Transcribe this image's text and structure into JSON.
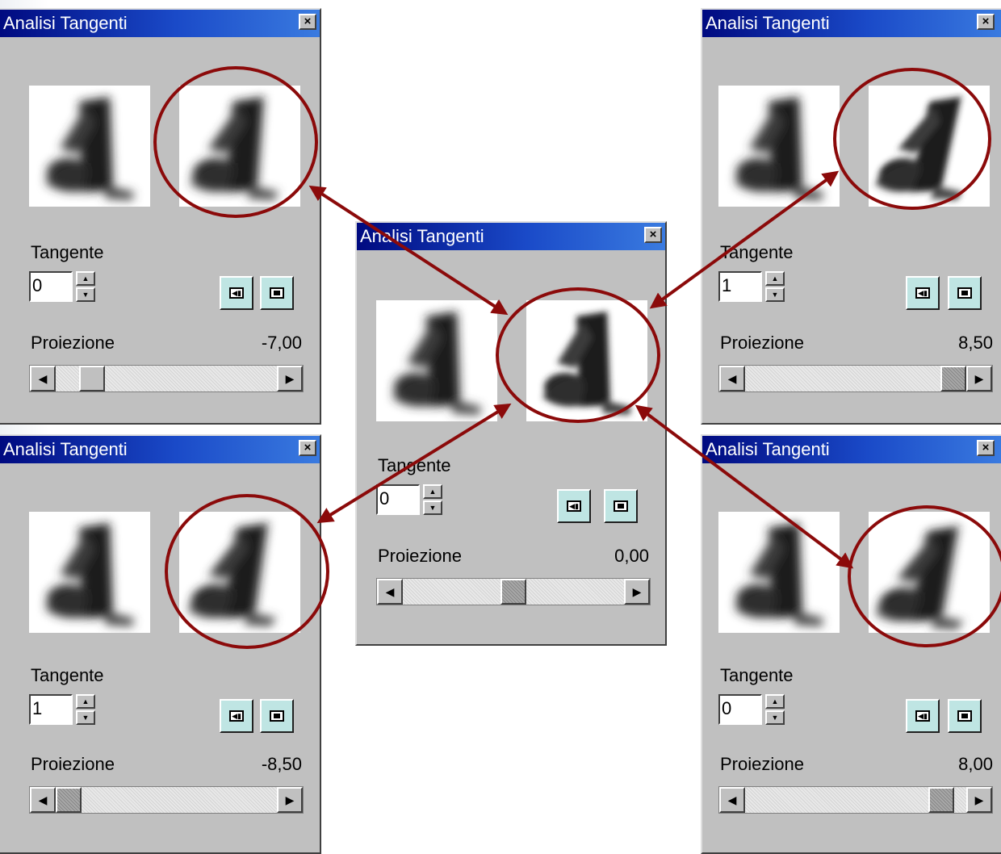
{
  "windows": [
    {
      "id": "tl",
      "title": "Analisi Tangenti",
      "close": "×",
      "tangente_label": "Tangente",
      "tangente_value": "0",
      "proiezione_label": "Proiezione",
      "proiezione_value": "-7,00",
      "slider_position": 0.12
    },
    {
      "id": "bl",
      "title": "Analisi Tangenti",
      "close": "×",
      "tangente_label": "Tangente",
      "tangente_value": "1",
      "proiezione_label": "Proiezione",
      "proiezione_value": "-8,50",
      "slider_position": 0.0
    },
    {
      "id": "c",
      "title": "Analisi Tangenti",
      "close": "×",
      "tangente_label": "Tangente",
      "tangente_value": "0",
      "proiezione_label": "Proiezione",
      "proiezione_value": "0,00",
      "slider_position": 0.5
    },
    {
      "id": "tr",
      "title": "Analisi Tangenti",
      "close": "×",
      "tangente_label": "Tangente",
      "tangente_value": "1",
      "proiezione_label": "Proiezione",
      "proiezione_value": "8,50",
      "slider_position": 1.0
    },
    {
      "id": "br",
      "title": "Analisi Tangenti",
      "close": "×",
      "tangente_label": "Tangente",
      "tangente_value": "0",
      "proiezione_label": "Proiezione",
      "proiezione_value": "8,00",
      "slider_position": 0.94
    }
  ],
  "colors": {
    "annotation": "#8b0a0a",
    "title_bar_start": "#000a80",
    "title_bar_end": "#3a7be0",
    "button_face": "#bfe5e3",
    "window_face": "#c0c0c0"
  },
  "icons": {
    "close": "close-icon",
    "prev": "step-back-icon",
    "stop": "stop-icon",
    "spin_up": "spin-up-icon",
    "spin_down": "spin-down-icon",
    "scroll_left": "scroll-left-icon",
    "scroll_right": "scroll-right-icon"
  }
}
